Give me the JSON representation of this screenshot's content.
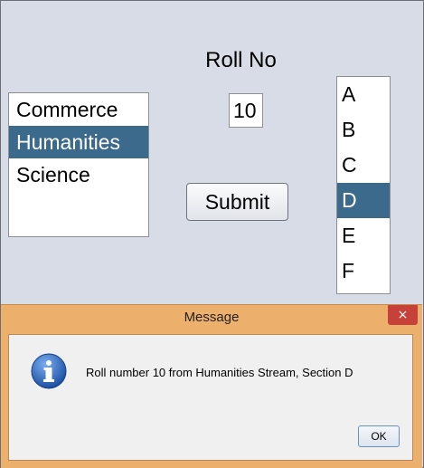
{
  "form": {
    "roll_label": "Roll No",
    "roll_value": "10",
    "submit_label": "Submit"
  },
  "streams": {
    "items": [
      "Commerce",
      "Humanities",
      "Science"
    ],
    "selected": "Humanities"
  },
  "sections": {
    "items": [
      "A",
      "B",
      "C",
      "D",
      "E",
      "F"
    ],
    "selected": "D"
  },
  "dialog": {
    "title": "Message",
    "close_glyph": "×",
    "message": "Roll number 10 from Humanities Stream, Section D",
    "ok_label": "OK"
  },
  "colors": {
    "selection": "#3b6a8d",
    "window_bg": "#d8dce6",
    "dialog_frame": "#ecaf6c",
    "close_button": "#c8403a"
  }
}
